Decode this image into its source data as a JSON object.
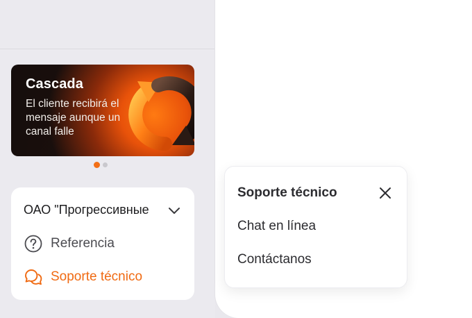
{
  "banner": {
    "title": "Cascada",
    "text": "El cliente recibirá el mensaje aunque un canal falle",
    "slides_total": 2,
    "slide_active": 1
  },
  "account": {
    "company": "ОАО \"Прогрессивные",
    "chevron_icon": "chevron-down-icon"
  },
  "menu": {
    "reference_label": "Referencia",
    "reference_icon": "question-circle-icon",
    "support_label": "Soporte técnico",
    "support_icon": "chat-bubbles-icon"
  },
  "popup": {
    "title": "Soporte técnico",
    "close_icon": "close-icon",
    "items": [
      "Chat en línea",
      "Contáctanos"
    ]
  },
  "colors": {
    "accent": "#f06a12",
    "sidebar_bg": "#ebeaef",
    "card_bg": "#ffffff",
    "text": "#2c2c30"
  }
}
